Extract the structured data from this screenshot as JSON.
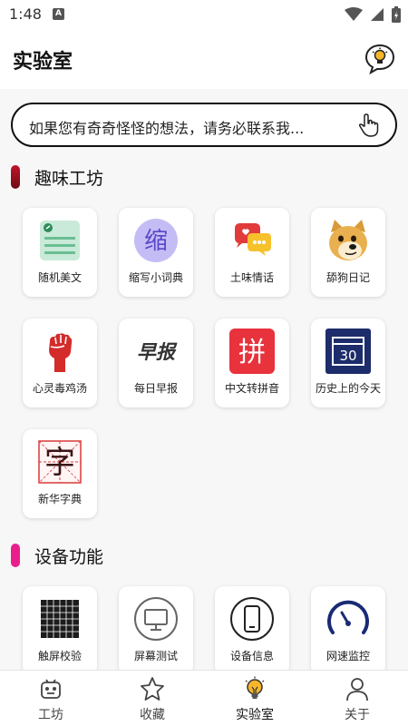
{
  "status_bar": {
    "time": "1:48",
    "notification_letter": "A"
  },
  "header": {
    "title": "实验室"
  },
  "search": {
    "text": "如果您有奇奇怪怪的想法，请务必联系我..."
  },
  "sections": [
    {
      "title": "趣味工坊",
      "accent_color": "#8b0d1b",
      "items": [
        {
          "label": "随机美文",
          "icon": "article-icon"
        },
        {
          "label": "缩写小词典",
          "icon": "abbreviation-icon",
          "glyph": "缩"
        },
        {
          "label": "土味情话",
          "icon": "love-chat-icon"
        },
        {
          "label": "舔狗日记",
          "icon": "doge-icon"
        },
        {
          "label": "心灵毒鸡汤",
          "icon": "fist-icon"
        },
        {
          "label": "每日早报",
          "icon": "morning-news-icon",
          "glyph": "早报"
        },
        {
          "label": "中文转拼音",
          "icon": "pinyin-icon",
          "glyph": "拼"
        },
        {
          "label": "历史上的今天",
          "icon": "calendar-icon",
          "glyph": "30"
        },
        {
          "label": "新华字典",
          "icon": "dictionary-icon",
          "glyph": "字"
        }
      ]
    },
    {
      "title": "设备功能",
      "accent_color": "#e91e8c",
      "items": [
        {
          "label": "触屏校验",
          "icon": "touch-grid-icon"
        },
        {
          "label": "屏幕测试",
          "icon": "monitor-icon"
        },
        {
          "label": "设备信息",
          "icon": "phone-icon"
        },
        {
          "label": "网速监控",
          "icon": "speedometer-icon"
        }
      ]
    }
  ],
  "bottom_nav": {
    "active": "实验室",
    "items": [
      {
        "label": "工坊",
        "icon": "workshop-icon"
      },
      {
        "label": "收藏",
        "icon": "star-icon"
      },
      {
        "label": "实验室",
        "icon": "lab-bulb-icon"
      },
      {
        "label": "关于",
        "icon": "person-icon"
      }
    ]
  }
}
